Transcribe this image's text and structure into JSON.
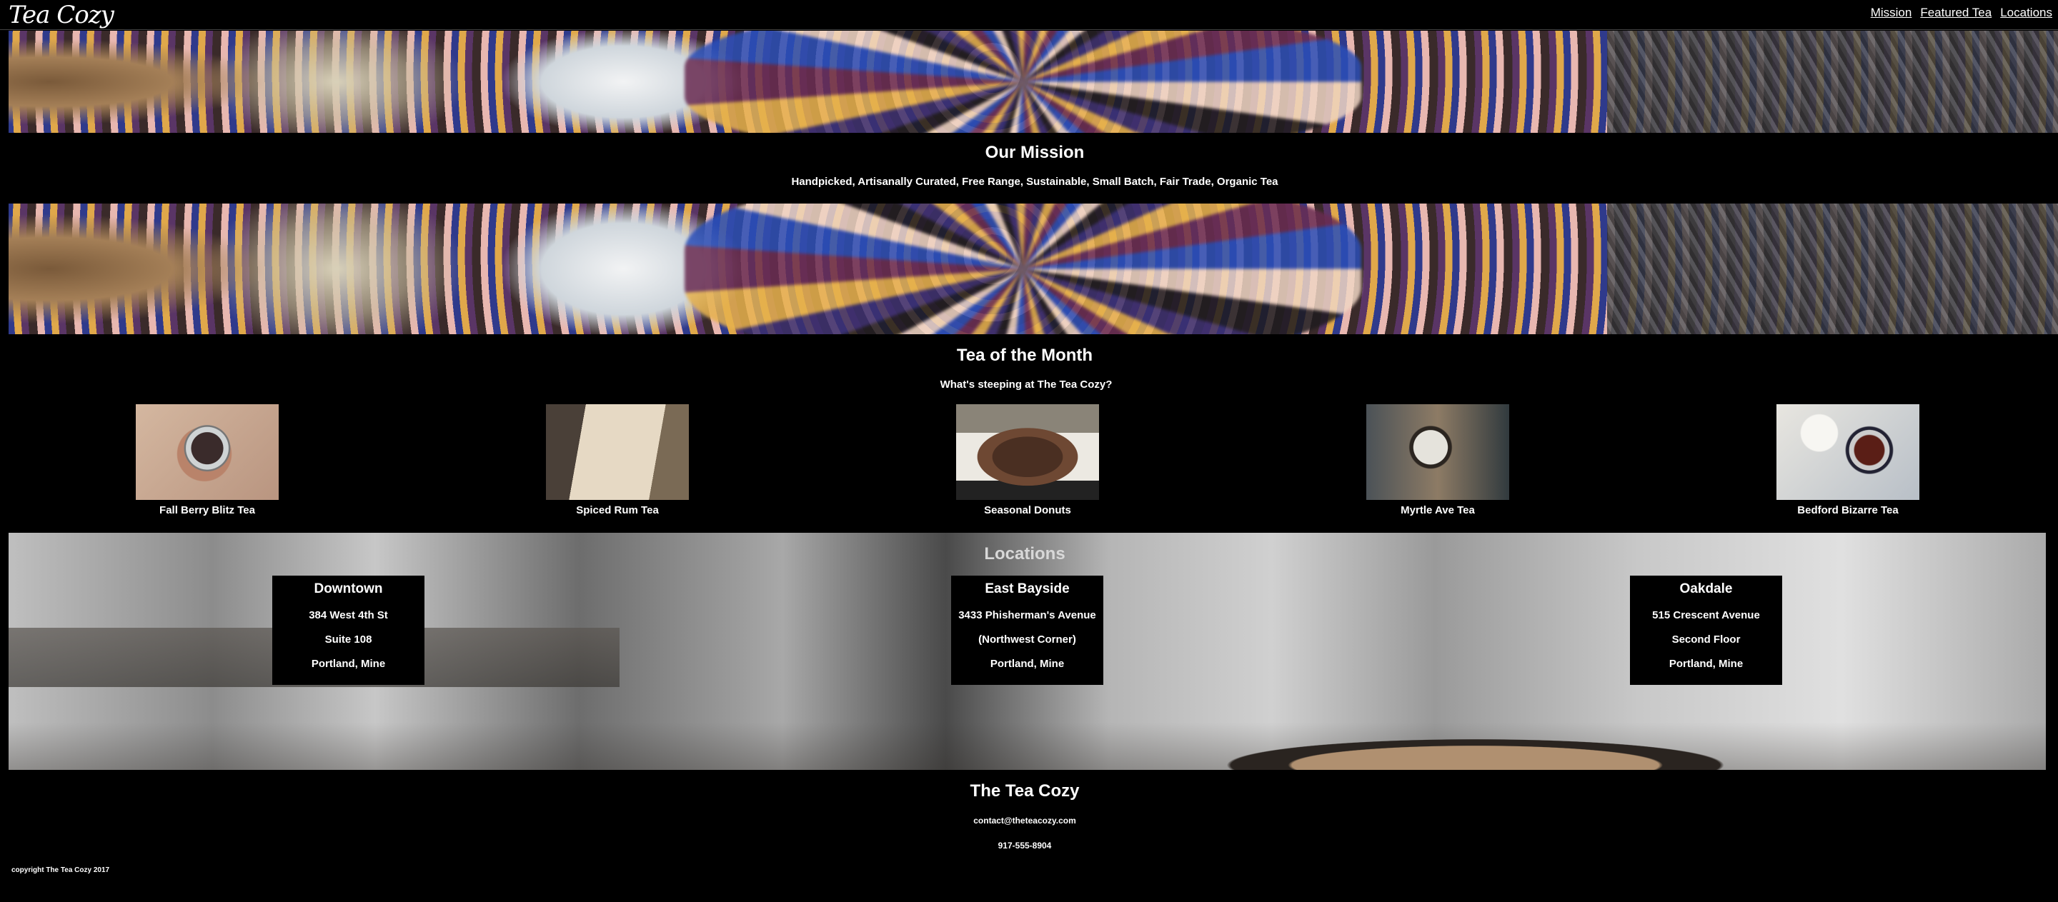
{
  "header": {
    "logo": "Tea Cozy",
    "nav": [
      {
        "label": "Mission"
      },
      {
        "label": "Featured Tea"
      },
      {
        "label": "Locations"
      }
    ]
  },
  "mission": {
    "title": "Our Mission",
    "subtitle": "Handpicked, Artisanally Curated, Free Range, Sustainable, Small Batch, Fair Trade, Organic Tea"
  },
  "tea_of_month": {
    "title": "Tea of the Month",
    "subtitle": "What's steeping at The Tea Cozy?",
    "items": [
      {
        "name": "Fall Berry Blitz Tea"
      },
      {
        "name": "Spiced Rum Tea"
      },
      {
        "name": "Seasonal Donuts"
      },
      {
        "name": "Myrtle Ave Tea"
      },
      {
        "name": "Bedford Bizarre Tea"
      }
    ]
  },
  "locations": {
    "title": "Locations",
    "items": [
      {
        "name": "Downtown",
        "lines": [
          "384 West 4th St",
          "Suite 108",
          "Portland, Mine"
        ]
      },
      {
        "name": "East Bayside",
        "lines": [
          "3433 Phisherman's Avenue",
          "(Northwest Corner)",
          "Portland, Mine"
        ]
      },
      {
        "name": "Oakdale",
        "lines": [
          "515 Crescent Avenue",
          "Second Floor",
          "Portland, Mine"
        ]
      }
    ]
  },
  "footer": {
    "title": "The Tea Cozy",
    "email": "contact@theteacozy.com",
    "phone": "917-555-8904",
    "copyright": "copyright The Tea Cozy 2017"
  }
}
